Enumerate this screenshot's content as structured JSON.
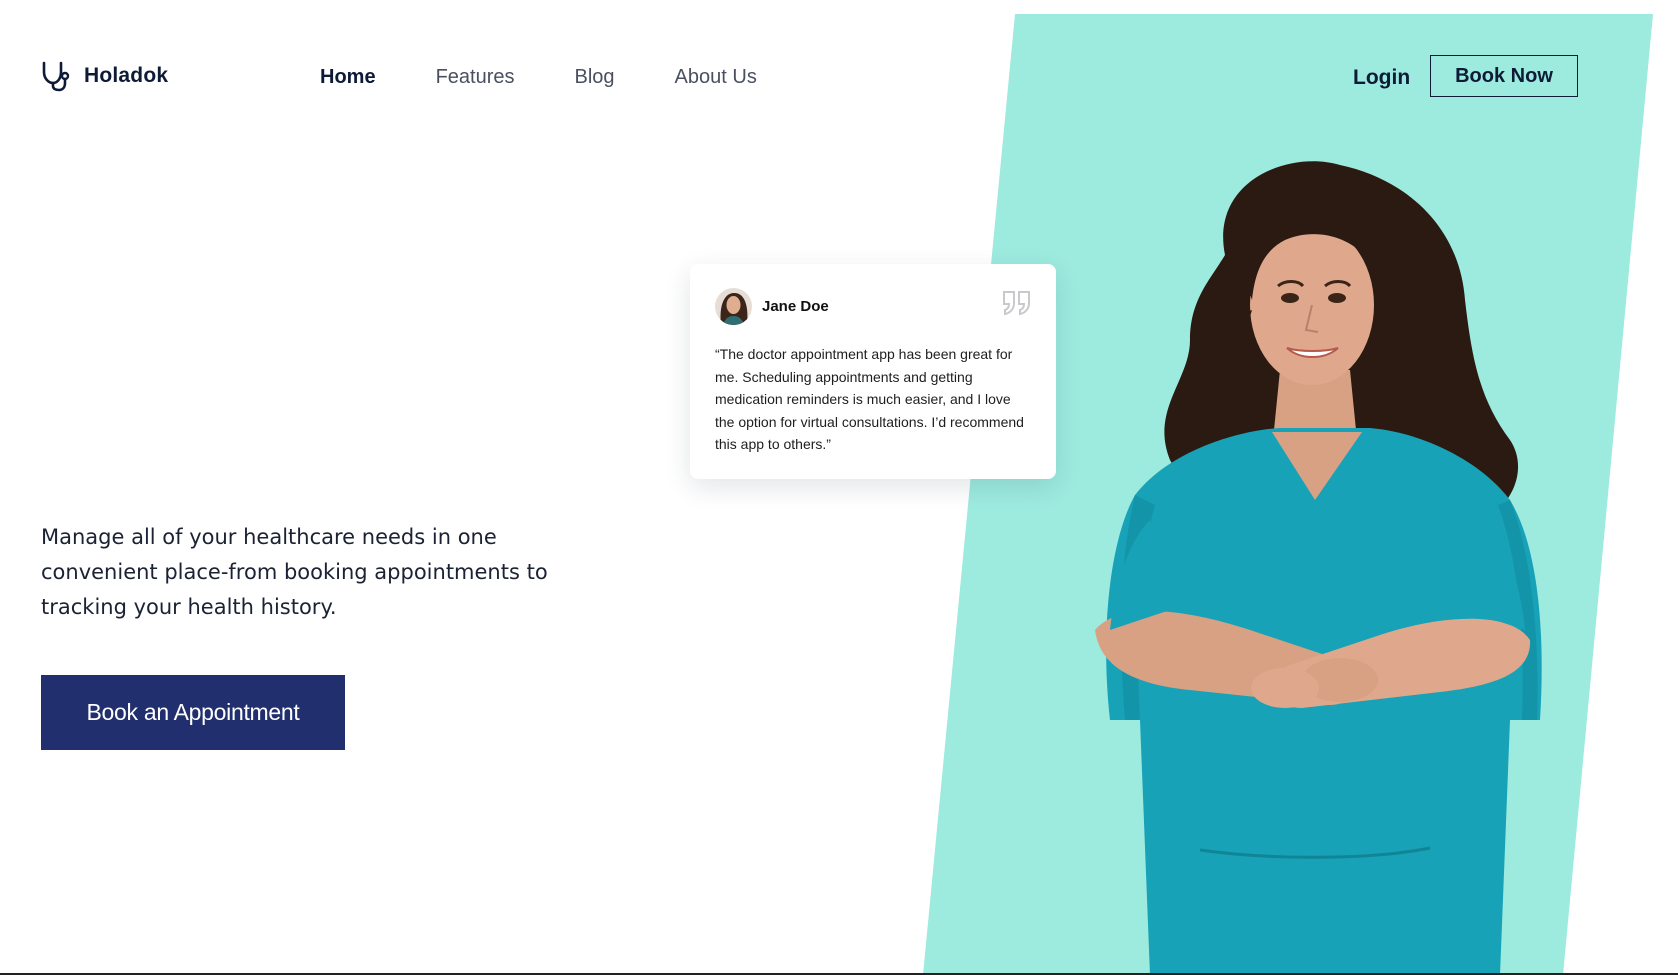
{
  "brand": {
    "name": "Holadok",
    "logo_icon": "stethoscope-icon"
  },
  "nav": {
    "items": [
      {
        "label": "Home",
        "active": true
      },
      {
        "label": "Features",
        "active": false
      },
      {
        "label": "Blog",
        "active": false
      },
      {
        "label": "About Us",
        "active": false
      }
    ],
    "login_label": "Login",
    "book_now_label": "Book Now"
  },
  "hero": {
    "description": "Manage all of your healthcare needs in one convenient place-from booking appointments to tracking your health history.",
    "cta_label": "Book an Appointment"
  },
  "testimonial": {
    "name": "Jane Doe",
    "quote": "“The doctor appointment app has been great for me. Scheduling appointments and getting medication reminders is much easier, and I love the option for virtual consultations. I’d recommend this app to others.”",
    "quote_icon": "quote-icon"
  },
  "colors": {
    "accent_mint": "#9deadf",
    "primary_navy": "#212f6e",
    "text_dark": "#0d1b36",
    "scrubs_teal": "#17a2b8"
  }
}
